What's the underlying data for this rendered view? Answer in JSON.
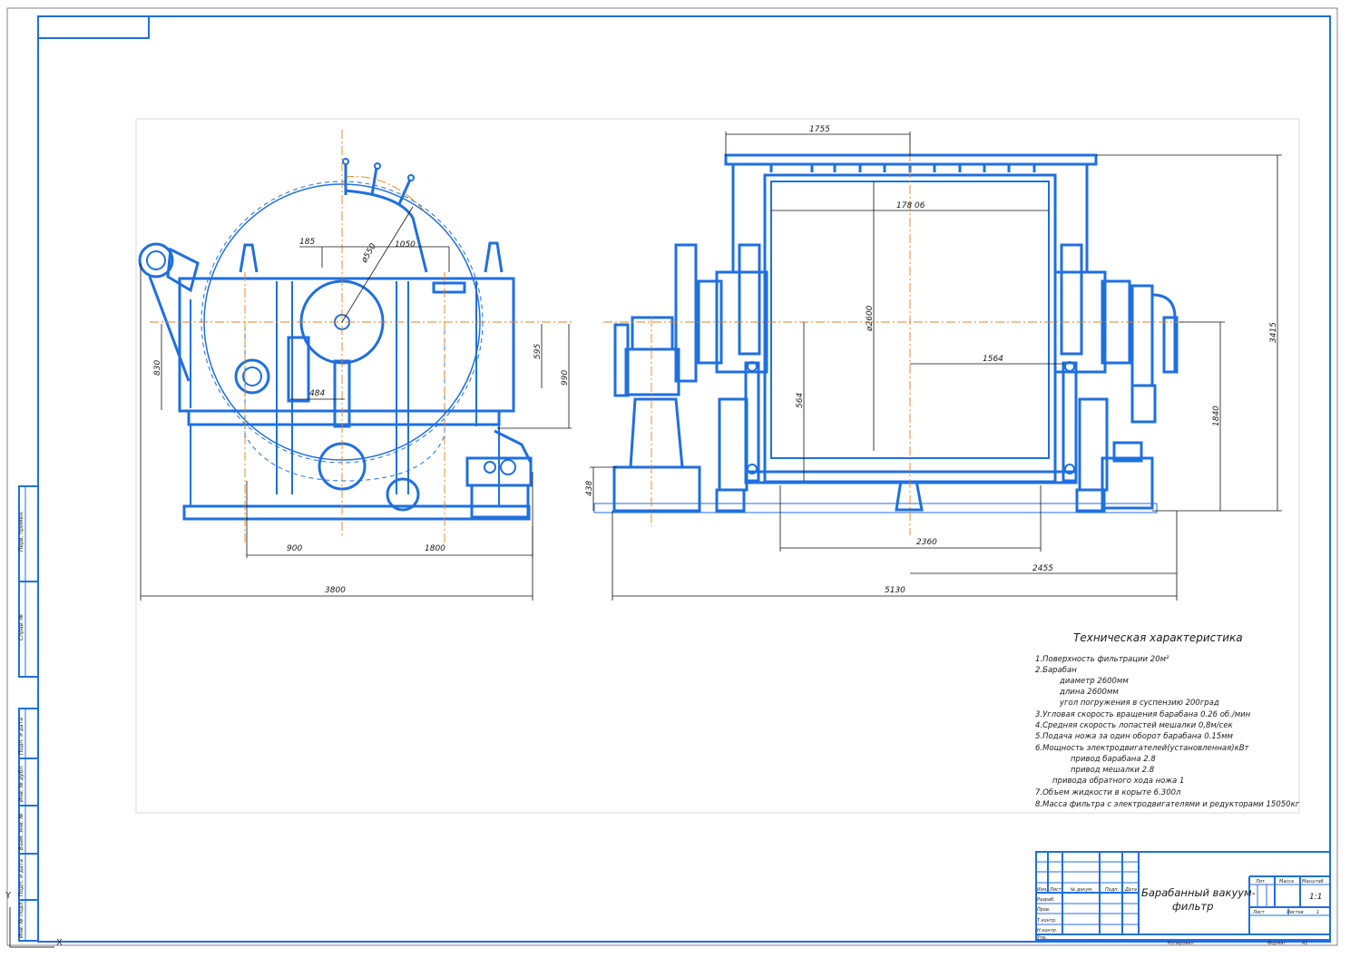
{
  "dimensions": {
    "d185": "185",
    "d1050": "1050",
    "d550": "ø550",
    "d595": "595",
    "d830": "830",
    "d990": "990",
    "d484": "484",
    "d900": "900",
    "d1800": "1800",
    "d3800": "3800",
    "d1755": "1755",
    "d17806": "178 06",
    "d2600": "ø2600",
    "d564": "564",
    "d1564": "1564",
    "d3415": "3415",
    "d1840": "1840",
    "d438": "438",
    "d2360": "2360",
    "d2455": "2455",
    "d5130": "5130"
  },
  "tech": {
    "title": "Техническая характеристика",
    "lines": [
      "1.Поверхность фильтрации 20м²",
      "2.Барабан",
      "диаметр 2600мм",
      "длина 2600мм",
      "угол погружения в суспензию 200град",
      "3.Угловая скорость вращения барабана 0.26 об./мин",
      "4.Средняя скорость лопастей мешалки 0,8м/сек",
      "5.Подача ножа за один оборот барабана 0.15мм",
      "6.Мощность электродвигателей(установленная)кВт",
      "привод барабана 2.8",
      "привод мешалки 2.8",
      "привода обратного хода ножа 1",
      "7.Объем жидкости в корыте 6.300л",
      "8.Масса фильтра с электродвигателями и редукторами 15050кг"
    ]
  },
  "title_block": {
    "name_line1": "Барабанный вакуум-",
    "name_line2": "фильтр",
    "lit": "Лит.",
    "mass": "Масса",
    "scale": "Масштаб",
    "scale_value": "1:1",
    "sheet": "Лист",
    "sheets": "Листов",
    "sheets_value": "1",
    "izm": "Изм.",
    "list": "Лист",
    "ndoc": "№ докум.",
    "podp": "Подп.",
    "data": "Дата",
    "razrab": "Разраб.",
    "prov": "Пров.",
    "tkontr": "Т.контр.",
    "nkontr": "Н.контр.",
    "utv": "Утв.",
    "copied": "Копировал",
    "format": "Формат",
    "format_value": "A1"
  },
  "side_stamp": {
    "perv_primen": "Перв. примен.",
    "sprav": "Справ. №",
    "podp_data1": "Подп. и дата",
    "inv_dubl": "Инв. № дубл.",
    "vzam_inv": "Взам. инв. №",
    "podp_data2": "Подп. и дата",
    "inv_podl": "Инв. № подл."
  },
  "axes": {
    "x": "X",
    "y": "Y"
  }
}
